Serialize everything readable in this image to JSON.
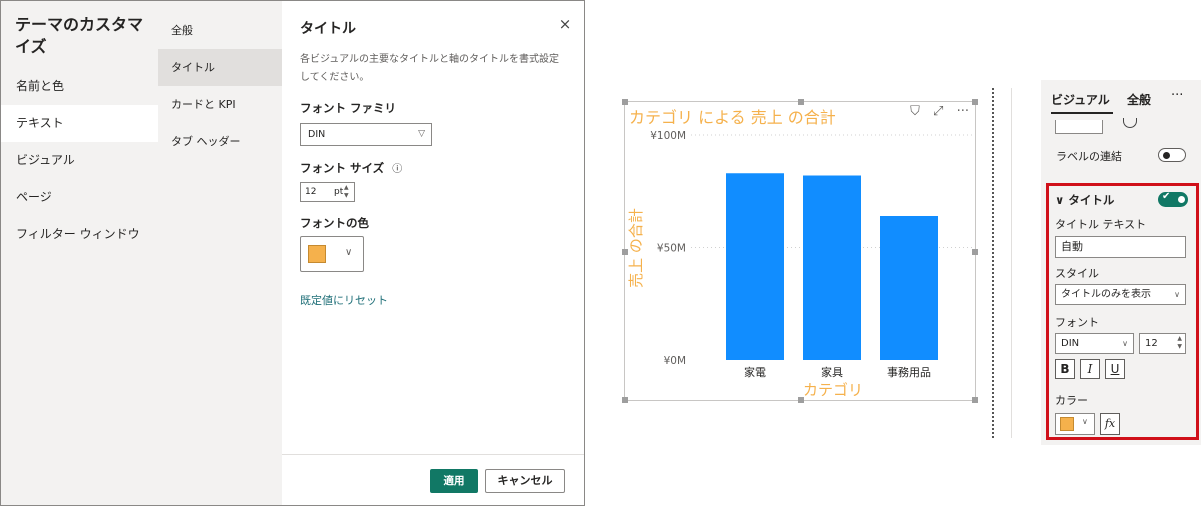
{
  "dialog": {
    "title": "テーマのカスタマイズ",
    "nav": [
      "名前と色",
      "テキスト",
      "ビジュアル",
      "ページ",
      "フィルター ウィンドウ"
    ],
    "sub_nav": [
      "全般",
      "タイトル",
      "カードと KPI",
      "タブ ヘッダー"
    ],
    "content": {
      "title": "タイトル",
      "close": "×",
      "description": "各ビジュアルの主要なタイトルと軸のタイトルを書式設定してください。",
      "font_family_label": "フォント ファミリ",
      "font_family_value": "DIN",
      "font_size_label": "フォント サイズ",
      "font_size_info": "ⓘ",
      "font_size_value": "12",
      "font_size_unit": "pt",
      "font_color_label": "フォントの色",
      "font_color": "#F5B14C",
      "reset": "既定値にリセット"
    },
    "footer": {
      "apply": "適用",
      "cancel": "キャンセル"
    }
  },
  "visual": {
    "tools": {
      "filter": "⛉",
      "focus": "⤢",
      "more": "···"
    }
  },
  "chart_data": {
    "type": "bar",
    "title": "カテゴリ による 売上 の合計",
    "title_color": "#F5B14C",
    "bar_color": "#118DFF",
    "categories": [
      "家電",
      "家具",
      "事務用品"
    ],
    "values": [
      83,
      82,
      64
    ],
    "value_unit": "M (¥)",
    "xlabel": "カテゴリ",
    "ylabel": "売上 の合計",
    "yticks": [
      "¥0M",
      "¥50M",
      "¥100M"
    ],
    "ylim": [
      0,
      100
    ],
    "grid": true
  },
  "pane": {
    "tabs": {
      "visual": "ビジュアル",
      "general": "全般",
      "more": "···"
    },
    "label_concat": "ラベルの連結",
    "title_section": {
      "header": "タイトル",
      "chevron": "∨",
      "enabled": true,
      "title_text_label": "タイトル テキスト",
      "title_text_value": "自動",
      "style_label": "スタイル",
      "style_value": "タイトルのみを表示",
      "font_label": "フォント",
      "font_family": "DIN",
      "font_size": "12",
      "bold": "B",
      "italic": "I",
      "underline": "U",
      "color_label": "カラー",
      "color": "#F5B14C",
      "fx": "fx"
    }
  }
}
